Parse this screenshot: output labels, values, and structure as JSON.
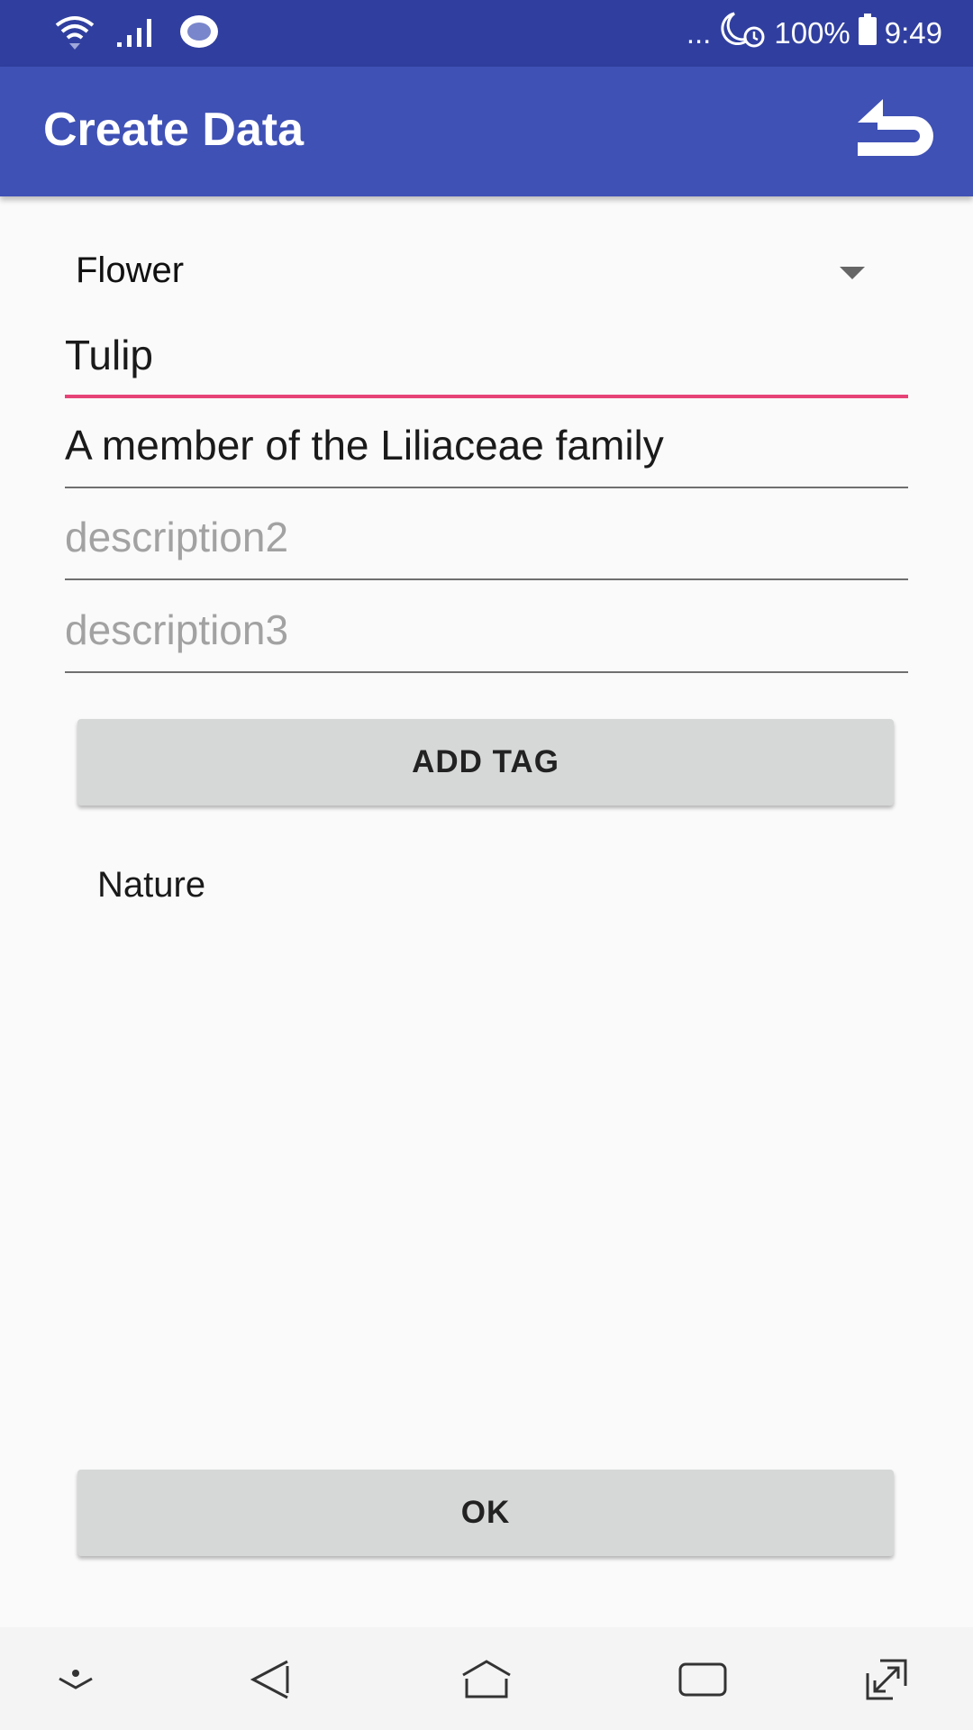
{
  "status_bar": {
    "dots": "...",
    "battery_percent": "100%",
    "time": "9:49",
    "icons": [
      "wifi-icon",
      "signal-icon",
      "sync-icon",
      "do-not-disturb-icon",
      "alarm-icon",
      "battery-icon"
    ]
  },
  "app_bar": {
    "title": "Create Data",
    "back_icon": "undo-arrow-icon",
    "color": "#3f51b5",
    "status_color": "#303f9f"
  },
  "form": {
    "category_selected": "Flower",
    "name_value": "Tulip",
    "description1_value": "A member of the Liliaceae family",
    "description2_placeholder": "description2",
    "description3_placeholder": "description3",
    "accent_color": "#e64478"
  },
  "buttons": {
    "add_tag_label": "ADD TAG",
    "ok_label": "OK"
  },
  "tags": {
    "items": [
      "Nature"
    ]
  },
  "nav_bar": {
    "icons": [
      "hide-keyboard-icon",
      "back-icon",
      "home-icon",
      "recents-icon",
      "rotate-icon"
    ]
  }
}
